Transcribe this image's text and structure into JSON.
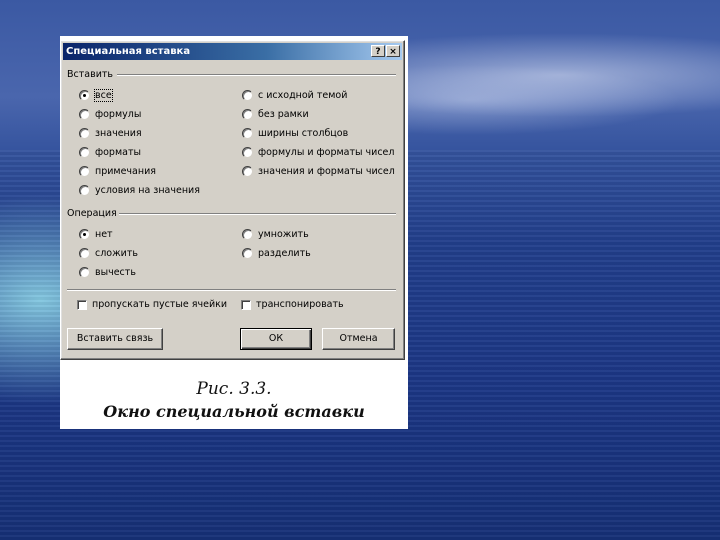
{
  "dialog": {
    "title": "Специальная вставка",
    "help_button": "?",
    "close_button": "×",
    "paste_group": {
      "label": "Вставить",
      "left_options": [
        "все",
        "формулы",
        "значения",
        "форматы",
        "примечания",
        "условия на значения"
      ],
      "right_options": [
        "с исходной темой",
        "без рамки",
        "ширины столбцов",
        "формулы и форматы чисел",
        "значения и форматы чисел"
      ],
      "selected": "все"
    },
    "operation_group": {
      "label": "Операция",
      "left_options": [
        "нет",
        "сложить",
        "вычесть"
      ],
      "right_options": [
        "умножить",
        "разделить"
      ],
      "selected": "нет"
    },
    "skip_blanks": "пропускать пустые ячейки",
    "transpose": "транспонировать",
    "paste_link_button": "Вставить связь",
    "ok_button": "ОК",
    "cancel_button": "Отмена"
  },
  "caption": {
    "line1": "Рис. 3.3.",
    "line2": "Окно специальной вставки"
  }
}
